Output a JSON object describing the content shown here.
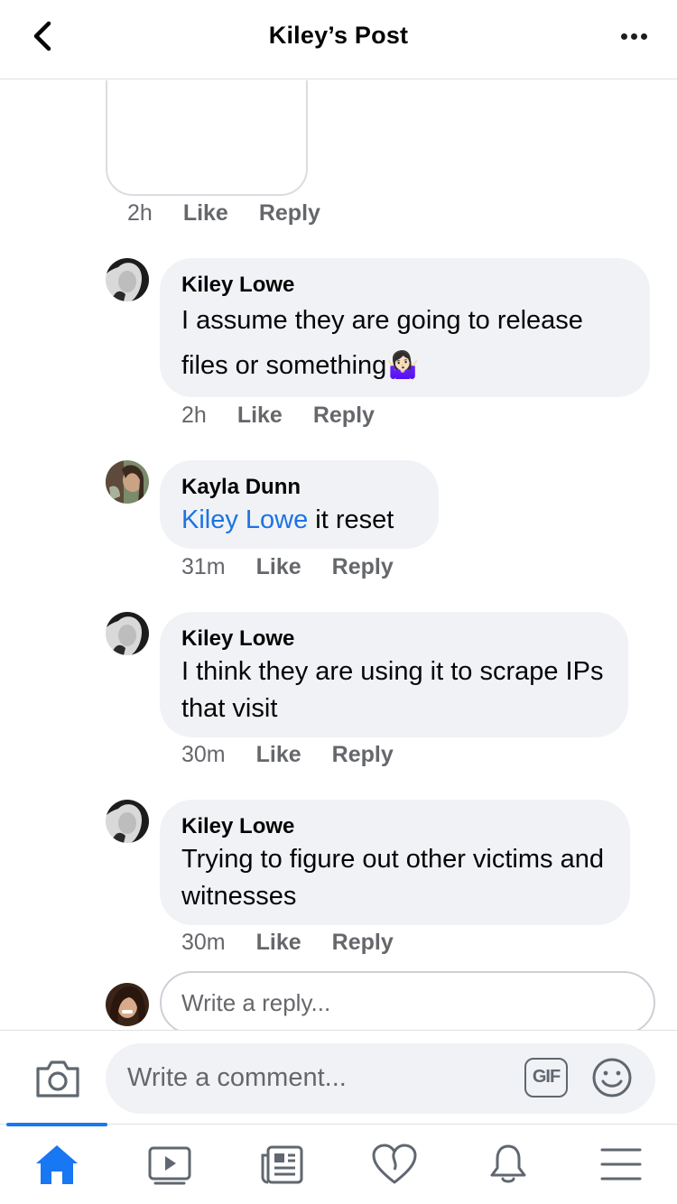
{
  "header": {
    "title": "Kiley’s Post"
  },
  "first_comment_meta": {
    "time": "2h",
    "like": "Like",
    "reply": "Reply"
  },
  "comments": [
    {
      "author": "Kiley Lowe",
      "text": "I assume they are going to release files or something🤷🏻‍♀️",
      "time": "2h",
      "like": "Like",
      "reply": "Reply"
    },
    {
      "author": "Kayla Dunn",
      "mention": "Kiley Lowe",
      "text": " it reset",
      "time": "31m",
      "like": "Like",
      "reply": "Reply"
    },
    {
      "author": "Kiley Lowe",
      "text": "I think they are using it to scrape IPs that visit",
      "time": "30m",
      "like": "Like",
      "reply": "Reply"
    },
    {
      "author": "Kiley Lowe",
      "text": "Trying to figure out other victims and witnesses",
      "time": "30m",
      "like": "Like",
      "reply": "Reply"
    }
  ],
  "reply_box": {
    "placeholder": "Write a reply..."
  },
  "comment_bar": {
    "placeholder": "Write a comment...",
    "gif_label": "GIF"
  },
  "tabs": [
    "home-icon",
    "video-icon",
    "news-icon",
    "dating-heart-icon",
    "bell-icon",
    "menu-icon"
  ],
  "colors": {
    "accent": "#1877f2",
    "mention": "#1b74e4",
    "bubble": "#f0f2f5",
    "meta_text": "#65676b"
  }
}
